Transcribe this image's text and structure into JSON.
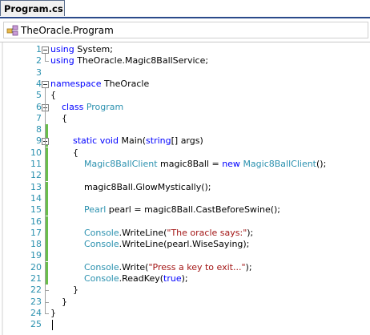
{
  "tab": {
    "label": "Program.cs"
  },
  "nav": {
    "label": "TheOracle.Program",
    "icon": "class-icon"
  },
  "editor": {
    "lines": [
      {
        "n": "1",
        "tokens": [
          {
            "t": "using",
            "c": "kw"
          },
          {
            "t": " System;",
            "c": ""
          }
        ]
      },
      {
        "n": "2",
        "tokens": [
          {
            "t": "using",
            "c": "kw"
          },
          {
            "t": " TheOracle.Magic8BallService;",
            "c": ""
          }
        ]
      },
      {
        "n": "3",
        "tokens": []
      },
      {
        "n": "4",
        "tokens": [
          {
            "t": "namespace",
            "c": "kw"
          },
          {
            "t": " TheOracle",
            "c": ""
          }
        ]
      },
      {
        "n": "5",
        "tokens": [
          {
            "t": "{",
            "c": ""
          }
        ]
      },
      {
        "n": "6",
        "tokens": [
          {
            "t": "    ",
            "c": ""
          },
          {
            "t": "class",
            "c": "kw"
          },
          {
            "t": " ",
            "c": ""
          },
          {
            "t": "Program",
            "c": "ty"
          }
        ]
      },
      {
        "n": "7",
        "tokens": [
          {
            "t": "    {",
            "c": ""
          }
        ]
      },
      {
        "n": "8",
        "tokens": []
      },
      {
        "n": "9",
        "tokens": [
          {
            "t": "        ",
            "c": ""
          },
          {
            "t": "static",
            "c": "kw"
          },
          {
            "t": " ",
            "c": ""
          },
          {
            "t": "void",
            "c": "kw"
          },
          {
            "t": " Main(",
            "c": ""
          },
          {
            "t": "string",
            "c": "kw"
          },
          {
            "t": "[] args)",
            "c": ""
          }
        ]
      },
      {
        "n": "10",
        "tokens": [
          {
            "t": "        {",
            "c": ""
          }
        ]
      },
      {
        "n": "11",
        "tokens": [
          {
            "t": "            ",
            "c": ""
          },
          {
            "t": "Magic8BallClient",
            "c": "ty"
          },
          {
            "t": " magic8Ball = ",
            "c": ""
          },
          {
            "t": "new",
            "c": "kw"
          },
          {
            "t": " ",
            "c": ""
          },
          {
            "t": "Magic8BallClient",
            "c": "ty"
          },
          {
            "t": "();",
            "c": ""
          }
        ]
      },
      {
        "n": "12",
        "tokens": []
      },
      {
        "n": "13",
        "tokens": [
          {
            "t": "            magic8Ball.GlowMystically();",
            "c": ""
          }
        ]
      },
      {
        "n": "14",
        "tokens": []
      },
      {
        "n": "15",
        "tokens": [
          {
            "t": "            ",
            "c": ""
          },
          {
            "t": "Pearl",
            "c": "ty"
          },
          {
            "t": " pearl = magic8Ball.CastBeforeSwine();",
            "c": ""
          }
        ]
      },
      {
        "n": "16",
        "tokens": []
      },
      {
        "n": "17",
        "tokens": [
          {
            "t": "            ",
            "c": ""
          },
          {
            "t": "Console",
            "c": "ty"
          },
          {
            "t": ".WriteLine(",
            "c": ""
          },
          {
            "t": "\"The oracle says:\"",
            "c": "st"
          },
          {
            "t": ");",
            "c": ""
          }
        ]
      },
      {
        "n": "18",
        "tokens": [
          {
            "t": "            ",
            "c": ""
          },
          {
            "t": "Console",
            "c": "ty"
          },
          {
            "t": ".WriteLine(pearl.WiseSaying);",
            "c": ""
          }
        ]
      },
      {
        "n": "19",
        "tokens": []
      },
      {
        "n": "20",
        "tokens": [
          {
            "t": "            ",
            "c": ""
          },
          {
            "t": "Console",
            "c": "ty"
          },
          {
            "t": ".Write(",
            "c": ""
          },
          {
            "t": "\"Press a key to exit...\"",
            "c": "st"
          },
          {
            "t": ");",
            "c": ""
          }
        ]
      },
      {
        "n": "21",
        "tokens": [
          {
            "t": "            ",
            "c": ""
          },
          {
            "t": "Console",
            "c": "ty"
          },
          {
            "t": ".ReadKey(",
            "c": ""
          },
          {
            "t": "true",
            "c": "kw"
          },
          {
            "t": ");",
            "c": ""
          }
        ]
      },
      {
        "n": "22",
        "tokens": [
          {
            "t": "        }",
            "c": ""
          }
        ]
      },
      {
        "n": "23",
        "tokens": [
          {
            "t": "    }",
            "c": ""
          }
        ]
      },
      {
        "n": "24",
        "tokens": [
          {
            "t": "}",
            "c": ""
          }
        ]
      },
      {
        "n": "25",
        "tokens": []
      }
    ],
    "changed_lines": [
      "8",
      "9",
      "10",
      "11",
      "12",
      "13",
      "14",
      "15",
      "16",
      "17",
      "18",
      "19",
      "20",
      "21"
    ],
    "fold_lines": [
      "1",
      "4",
      "6",
      "9"
    ]
  },
  "colors": {
    "keyword": "#0000ff",
    "type": "#2b91af",
    "string": "#a31515",
    "line_number": "#2b91af",
    "change_marker": "#6abf4b"
  }
}
